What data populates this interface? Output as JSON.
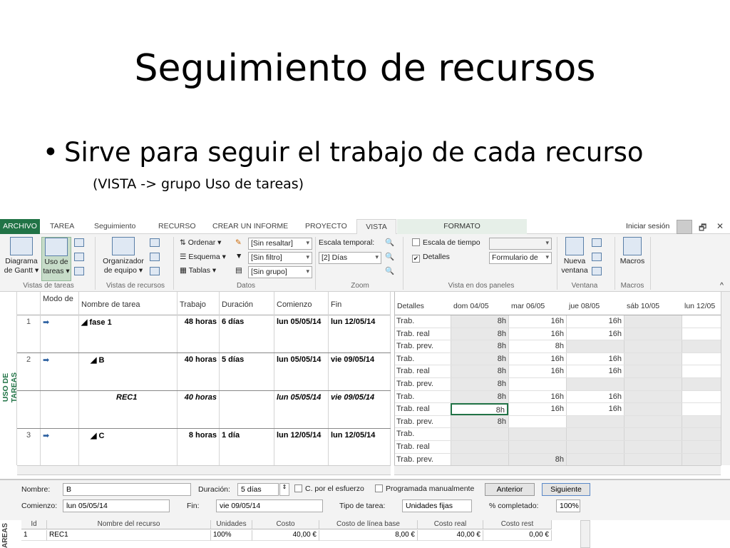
{
  "slide": {
    "title": "Seguimiento de recursos",
    "bullet": "Sirve para seguir el trabajo de cada recurso",
    "bullet_symbol": "•",
    "sub": "(VISTA -> grupo Uso de tareas)"
  },
  "tabs": [
    "ARCHIVO",
    "TAREA",
    "Seguimiento",
    "RECURSO",
    "CREAR UN INFORME",
    "PROYECTO",
    "VISTA"
  ],
  "context_tab": "FORMATO",
  "signin": "Iniciar sesión",
  "ribbon": {
    "gantt": "Diagrama de Gantt",
    "gantt_l1": "Diagrama",
    "gantt_l2": "de Gantt ▾",
    "uso_l1": "Uso de",
    "uso_l2": "tareas ▾",
    "org_l1": "Organizador",
    "org_l2": "de equipo ▾",
    "ordenar": "Ordenar ▾",
    "esquema": "Esquema ▾",
    "tablas": "Tablas ▾",
    "resaltar": "[Sin resaltar]",
    "filtro": "[Sin filtro]",
    "grupo": "[Sin grupo]",
    "escala_label": "Escala temporal:",
    "escala": "[2] Días",
    "tiempo_check": "Escala de tiempo",
    "detalles_check": "Detalles",
    "formulario": "Formulario de",
    "nueva_l1": "Nueva",
    "nueva_l2": "ventana",
    "macros": "Macros",
    "groups": [
      "Vistas de tareas",
      "Vistas de recursos",
      "Datos",
      "Zoom",
      "Vista en dos paneles",
      "Ventana",
      "Macros"
    ]
  },
  "side_label": "USO DE TAREAS",
  "grid": {
    "headers": [
      "Modo de",
      "Nombre de tarea",
      "Trabajo",
      "Duración",
      "Comienzo",
      "Fin"
    ],
    "rows": [
      {
        "id": "1",
        "name": "◢ fase 1",
        "work": "48 horas",
        "dur": "6 días",
        "start": "lun 05/05/14",
        "end": "lun 12/05/14"
      },
      {
        "id": "2",
        "name": "◢ B",
        "work": "40 horas",
        "dur": "5 días",
        "start": "lun 05/05/14",
        "end": "vie 09/05/14"
      },
      {
        "id": "",
        "name": "REC1",
        "work": "40 horas",
        "dur": "",
        "start": "lun 05/05/14",
        "end": "vie 09/05/14"
      },
      {
        "id": "3",
        "name": "◢ C",
        "work": "8 horas",
        "dur": "1 día",
        "start": "lun 12/05/14",
        "end": "lun 12/05/14"
      }
    ]
  },
  "timephased": {
    "detail_header": "Detalles",
    "dates": [
      "dom 04/05",
      "mar 06/05",
      "jue 08/05",
      "sáb 10/05",
      "lun 12/05"
    ],
    "rows": [
      {
        "label": "Trab.",
        "v": [
          "8h",
          "16h",
          "16h",
          "",
          ""
        ]
      },
      {
        "label": "Trab. real",
        "v": [
          "8h",
          "16h",
          "16h",
          "",
          ""
        ]
      },
      {
        "label": "Trab. prev.",
        "v": [
          "8h",
          "8h",
          "",
          "",
          ""
        ]
      },
      {
        "label": "Trab.",
        "v": [
          "8h",
          "16h",
          "16h",
          "",
          ""
        ]
      },
      {
        "label": "Trab. real",
        "v": [
          "8h",
          "16h",
          "16h",
          "",
          ""
        ]
      },
      {
        "label": "Trab. prev.",
        "v": [
          "8h",
          "",
          "",
          "",
          ""
        ]
      },
      {
        "label": "Trab.",
        "v": [
          "8h",
          "16h",
          "16h",
          "",
          ""
        ]
      },
      {
        "label": "Trab. real",
        "v": [
          "8h",
          "16h",
          "16h",
          "",
          ""
        ]
      },
      {
        "label": "Trab. prev.",
        "v": [
          "8h",
          "",
          "",
          "",
          ""
        ]
      },
      {
        "label": "Trab.",
        "v": [
          "",
          "",
          "",
          "",
          ""
        ]
      },
      {
        "label": "Trab. real",
        "v": [
          "",
          "",
          "",
          "",
          ""
        ]
      },
      {
        "label": "Trab. prev.",
        "v": [
          "",
          "8h",
          "",
          "",
          ""
        ]
      }
    ]
  },
  "form": {
    "nombre_label": "Nombre:",
    "nombre": "B",
    "duracion_label": "Duración:",
    "duracion": "5 días",
    "esfuerzo": "C. por el esfuerzo",
    "manual": "Programada manualmente",
    "anterior": "Anterior",
    "siguiente": "Siguiente",
    "comienzo_label": "Comienzo:",
    "comienzo": "lun 05/05/14",
    "fin_label": "Fin:",
    "fin": "vie 09/05/14",
    "tipo_label": "Tipo de tarea:",
    "tipo": "Unidades fijas",
    "completado_label": "% completado:",
    "completado": "100%",
    "side_label": "AREAS",
    "headers": [
      "Id",
      "Nombre del recurso",
      "Unidades",
      "Costo",
      "Costo de línea base",
      "Costo real",
      "Costo rest"
    ],
    "row": [
      "1",
      "REC1",
      "100%",
      "40,00 €",
      "8,00 €",
      "40,00 €",
      "0,00 €"
    ]
  }
}
